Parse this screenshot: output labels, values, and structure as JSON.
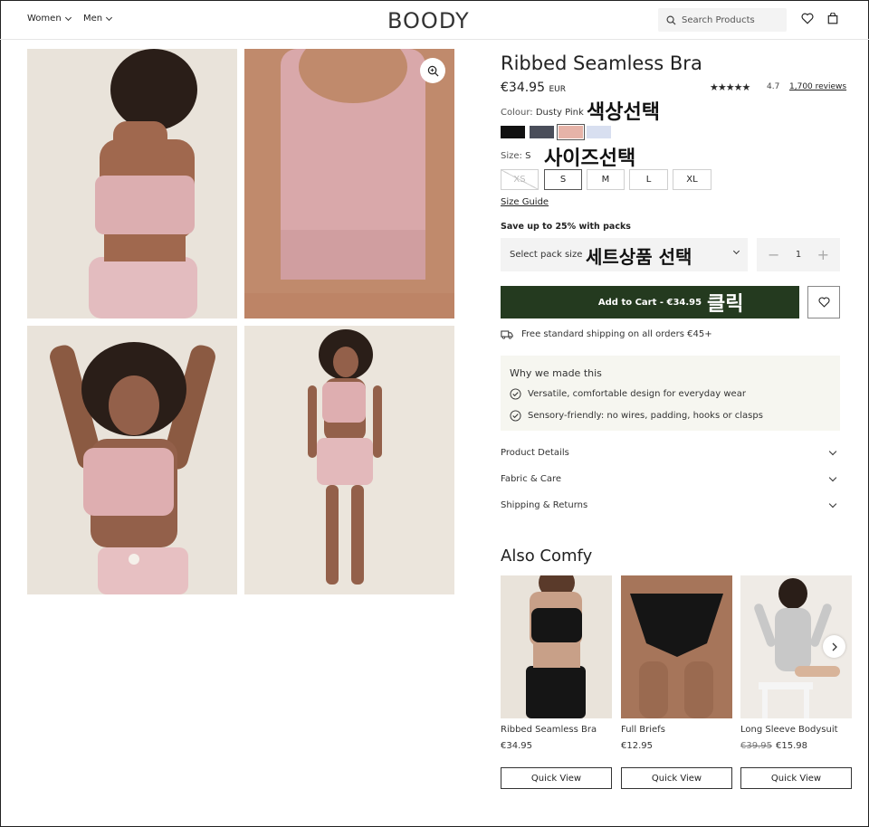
{
  "header": {
    "nav": [
      "Women",
      "Men"
    ],
    "logo": "BOODY",
    "search_placeholder": "Search Products"
  },
  "product": {
    "title": "Ribbed Seamless Bra",
    "price": "€34.95",
    "currency": "EUR",
    "rating": "4.7",
    "reviews": "1,700 reviews",
    "colour_label": "Colour:",
    "colour_value": "Dusty Pink",
    "swatches": [
      "#111111",
      "#4a4e5a",
      "#e6b3a8",
      "#d8dff0"
    ],
    "size_label": "Size:",
    "size_value": "S",
    "sizes": [
      "XS",
      "S",
      "M",
      "L",
      "XL"
    ],
    "size_guide": "Size Guide",
    "pack_promo": "Save up to 25% with packs",
    "pack_select": "Select pack size",
    "quantity": "1",
    "add_to_cart": "Add to Cart - €34.95",
    "shipping": "Free standard shipping on all orders €45+"
  },
  "annotations": {
    "color": "색상선택",
    "size": "사이즈선택",
    "pack": "세트상품  선택",
    "click": "클릭"
  },
  "why": {
    "title": "Why we made this",
    "items": [
      "Versatile, comfortable design for everyday wear",
      "Sensory-friendly: no wires, padding, hooks or clasps"
    ]
  },
  "accordion": [
    "Product Details",
    "Fabric & Care",
    "Shipping & Returns"
  ],
  "also": {
    "title": "Also Comfy",
    "items": [
      {
        "name": "Ribbed Seamless Bra",
        "price": "€34.95",
        "old_price": ""
      },
      {
        "name": "Full Briefs",
        "price": "€12.95",
        "old_price": ""
      },
      {
        "name": "Long Sleeve Bodysuit",
        "price": "€15.98",
        "old_price": "€39.95"
      }
    ],
    "quick_view": "Quick View"
  }
}
